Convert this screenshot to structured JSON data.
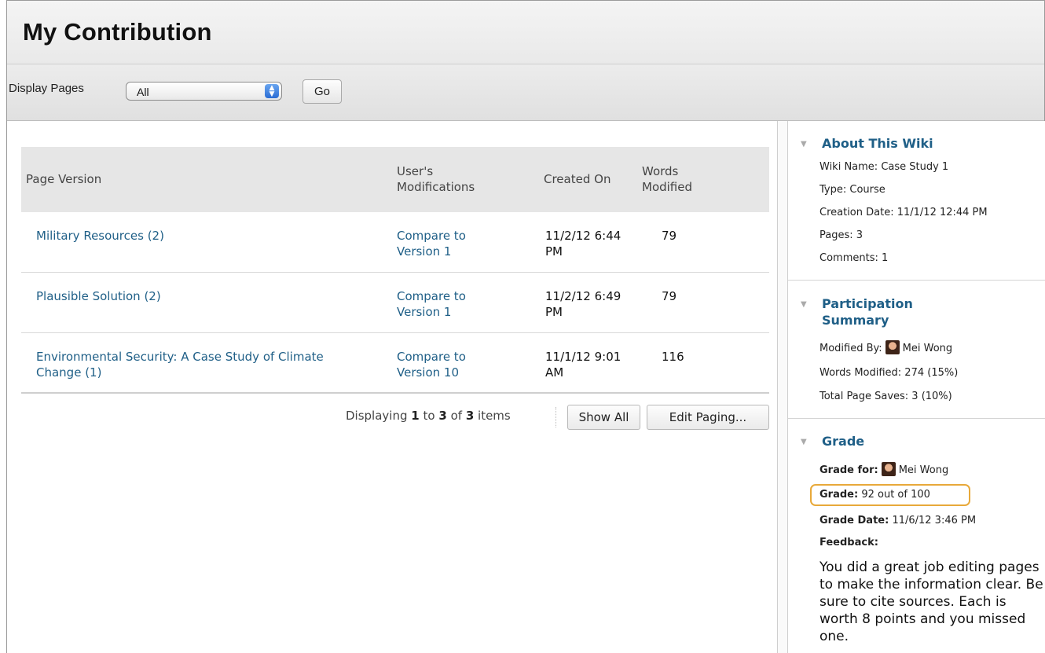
{
  "page": {
    "title": "My Contribution"
  },
  "toolbar": {
    "display_label": "Display Pages",
    "select_value": "All",
    "go_label": "Go"
  },
  "table": {
    "headers": {
      "page_version": "Page Version",
      "modifications_line1": "User's",
      "modifications_line2": "Modifications",
      "created_on": "Created On",
      "words_line1": "Words",
      "words_line2": "Modified"
    },
    "rows": [
      {
        "page_line1": "Military Resources (2)",
        "page_line2": "",
        "compare_line1": "Compare to",
        "compare_line2": "Version 1",
        "date_line1": "11/2/12 6:44",
        "date_line2": "PM",
        "words": "79"
      },
      {
        "page_line1": "Plausible Solution (2)",
        "page_line2": "",
        "compare_line1": "Compare to",
        "compare_line2": "Version 1",
        "date_line1": "11/2/12 6:49",
        "date_line2": "PM",
        "words": "79"
      },
      {
        "page_line1": "Environmental Security: A Case Study of Climate",
        "page_line2": "Change (1)",
        "compare_line1": "Compare to",
        "compare_line2": "Version 10",
        "date_line1": "11/1/12 9:01",
        "date_line2": "AM",
        "words": "116"
      }
    ]
  },
  "pager": {
    "prefix": "Displaying",
    "from": "1",
    "to_word": "to",
    "to": "3",
    "of_word": "of",
    "total": "3",
    "suffix": "items",
    "show_all": "Show All",
    "edit_paging": "Edit Paging..."
  },
  "sidebar": {
    "about": {
      "title": "About This Wiki",
      "wiki_name": "Wiki Name: Case Study 1",
      "type": "Type: Course",
      "creation_date": "Creation Date: 11/1/12 12:44 PM",
      "pages": "Pages: 3",
      "comments": "Comments: 1"
    },
    "participation": {
      "title_line1": "Participation",
      "title_line2": "Summary",
      "modified_by_label": "Modified By:",
      "modified_by_name": "Mei Wong",
      "words_modified": "Words Modified: 274 (15%)",
      "total_saves": "Total Page Saves: 3 (10%)"
    },
    "grade": {
      "title": "Grade",
      "grade_for_label": "Grade for:",
      "grade_for_name": "Mei Wong",
      "grade_label": "Grade:",
      "grade_value": "92 out of 100",
      "grade_date_label": "Grade Date:",
      "grade_date_value": "11/6/12 3:46 PM",
      "feedback_label": "Feedback:",
      "feedback_text": "You did a great job editing pages to make the information clear. Be sure to cite sources. Each is worth 8 points and you missed one."
    }
  },
  "colors": {
    "link": "#1f5f87",
    "highlight": "#e8a93a"
  }
}
